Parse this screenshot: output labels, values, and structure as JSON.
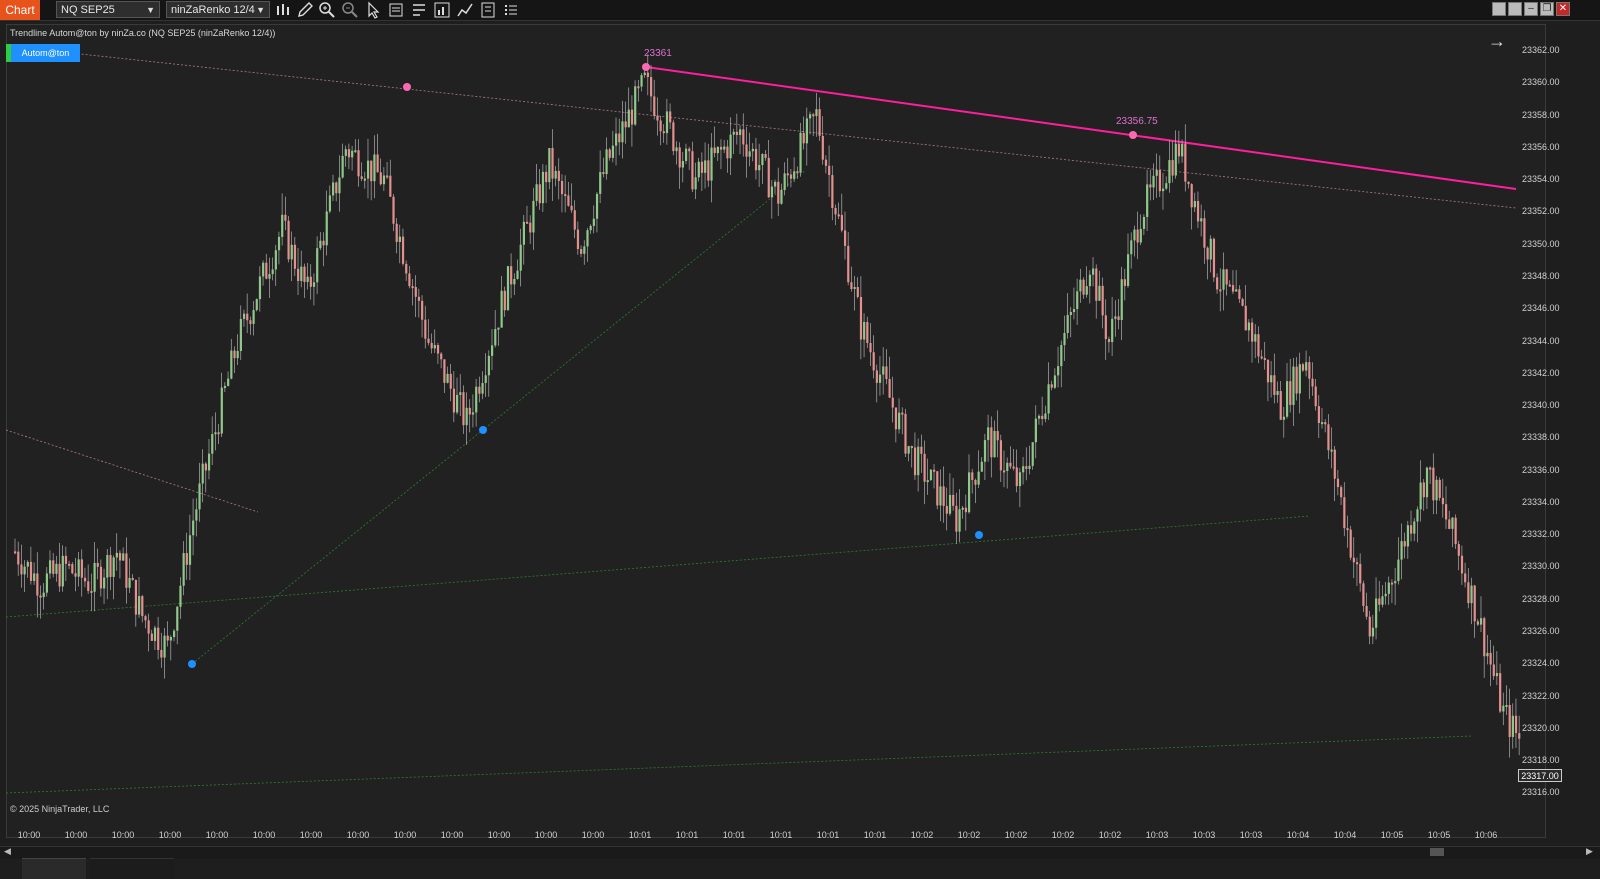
{
  "toolbar": {
    "chart_tab": "Chart",
    "instrument": "NQ SEP25",
    "bar_type": "ninZaRenko 12/4",
    "icons": [
      "bars-icon",
      "pencil-icon",
      "zoom-in-icon",
      "zoom-out-icon",
      "pointer-icon",
      "properties-icon",
      "templates-icon",
      "strategy-icon",
      "indicators-icon",
      "data-box-icon",
      "list-icon"
    ]
  },
  "chart": {
    "title": "Trendline Autom@ton by ninZa.co (NQ SEP25 (ninZaRenko 12/4))",
    "autom_button": "Autom@ton",
    "copyright": "© 2025 NinjaTrader, LLC",
    "last_price": "23317.00",
    "pivot_high_1": "23361",
    "pivot_high_2": "23356.75",
    "colors": {
      "up_bar": "#8fc98a",
      "down_bar": "#e58f8f",
      "trend_line": "#ff1e9e",
      "pivot_high": "#ff69b4",
      "pivot_low": "#1e90ff",
      "support_line": "#2e7d32",
      "resist_faint": "#b07a85"
    }
  },
  "price_axis": [
    "23362.00",
    "23360.00",
    "23358.00",
    "23356.00",
    "23354.00",
    "23352.00",
    "23350.00",
    "23348.00",
    "23346.00",
    "23344.00",
    "23342.00",
    "23340.00",
    "23338.00",
    "23336.00",
    "23334.00",
    "23332.00",
    "23330.00",
    "23328.00",
    "23326.00",
    "23324.00",
    "23322.00",
    "23320.00",
    "23318.00",
    "23316.00"
  ],
  "time_axis": [
    "10:00",
    "10:00",
    "10:00",
    "10:00",
    "10:00",
    "10:00",
    "10:00",
    "10:00",
    "10:00",
    "10:00",
    "10:00",
    "10:00",
    "10:00",
    "10:01",
    "10:01",
    "10:01",
    "10:01",
    "10:01",
    "10:01",
    "10:02",
    "10:02",
    "10:02",
    "10:02",
    "10:02",
    "10:03",
    "10:03",
    "10:03",
    "10:04",
    "10:04",
    "10:05",
    "10:05",
    "10:06"
  ],
  "chart_data": {
    "type": "candlestick",
    "instrument": "NQ SEP25",
    "close_path": [
      [
        0,
        23331
      ],
      [
        8,
        23329
      ],
      [
        16,
        23330
      ],
      [
        24,
        23329
      ],
      [
        32,
        23331
      ],
      [
        40,
        23327
      ],
      [
        48,
        23325
      ],
      [
        56,
        23333
      ],
      [
        70,
        23344
      ],
      [
        84,
        23351
      ],
      [
        92,
        23347
      ],
      [
        104,
        23356
      ],
      [
        116,
        23354
      ],
      [
        130,
        23344
      ],
      [
        142,
        23339
      ],
      [
        154,
        23347
      ],
      [
        168,
        23355
      ],
      [
        178,
        23350
      ],
      [
        186,
        23355
      ],
      [
        198,
        23360
      ],
      [
        214,
        23354
      ],
      [
        228,
        23357
      ],
      [
        240,
        23353
      ],
      [
        252,
        23358
      ],
      [
        266,
        23345
      ],
      [
        282,
        23337
      ],
      [
        296,
        23333
      ],
      [
        306,
        23338
      ],
      [
        316,
        23335
      ],
      [
        326,
        23342
      ],
      [
        338,
        23349
      ],
      [
        344,
        23344
      ],
      [
        354,
        23352
      ],
      [
        366,
        23356
      ],
      [
        378,
        23348
      ],
      [
        388,
        23345
      ],
      [
        398,
        23340
      ],
      [
        406,
        23343
      ],
      [
        416,
        23335
      ],
      [
        426,
        23326
      ],
      [
        434,
        23330
      ],
      [
        444,
        23336
      ],
      [
        452,
        23332
      ],
      [
        460,
        23327
      ],
      [
        468,
        23321
      ],
      [
        474,
        23319
      ]
    ],
    "pivot_highs": [
      23359.8,
      23361,
      23356.75
    ],
    "pivot_lows": [
      23324,
      23339,
      23332
    ],
    "y_range": [
      23315,
      23363
    ],
    "x_ticks_start": "10:00",
    "x_ticks_end": "10:06"
  }
}
